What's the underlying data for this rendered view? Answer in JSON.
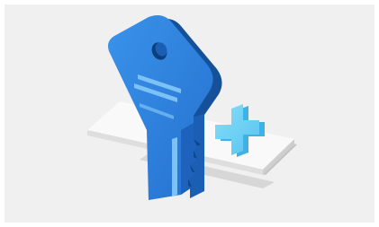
{
  "illustration": {
    "subject": "key-with-plus-icon",
    "colors": {
      "panel_background": "#f0f0f0",
      "key_face": "#2e83e0",
      "key_side": "#1a5fb3",
      "key_dark": "#15509a",
      "key_hole": "#0d3f7d",
      "key_stripes": "#7cc2f7",
      "plus_face": "#6cd2f6",
      "plus_side": "#3fb1e4",
      "card_top": "#f9f9f9",
      "card_edge": "#cfcfcf",
      "card_shadow": "#c4c4c4"
    }
  }
}
